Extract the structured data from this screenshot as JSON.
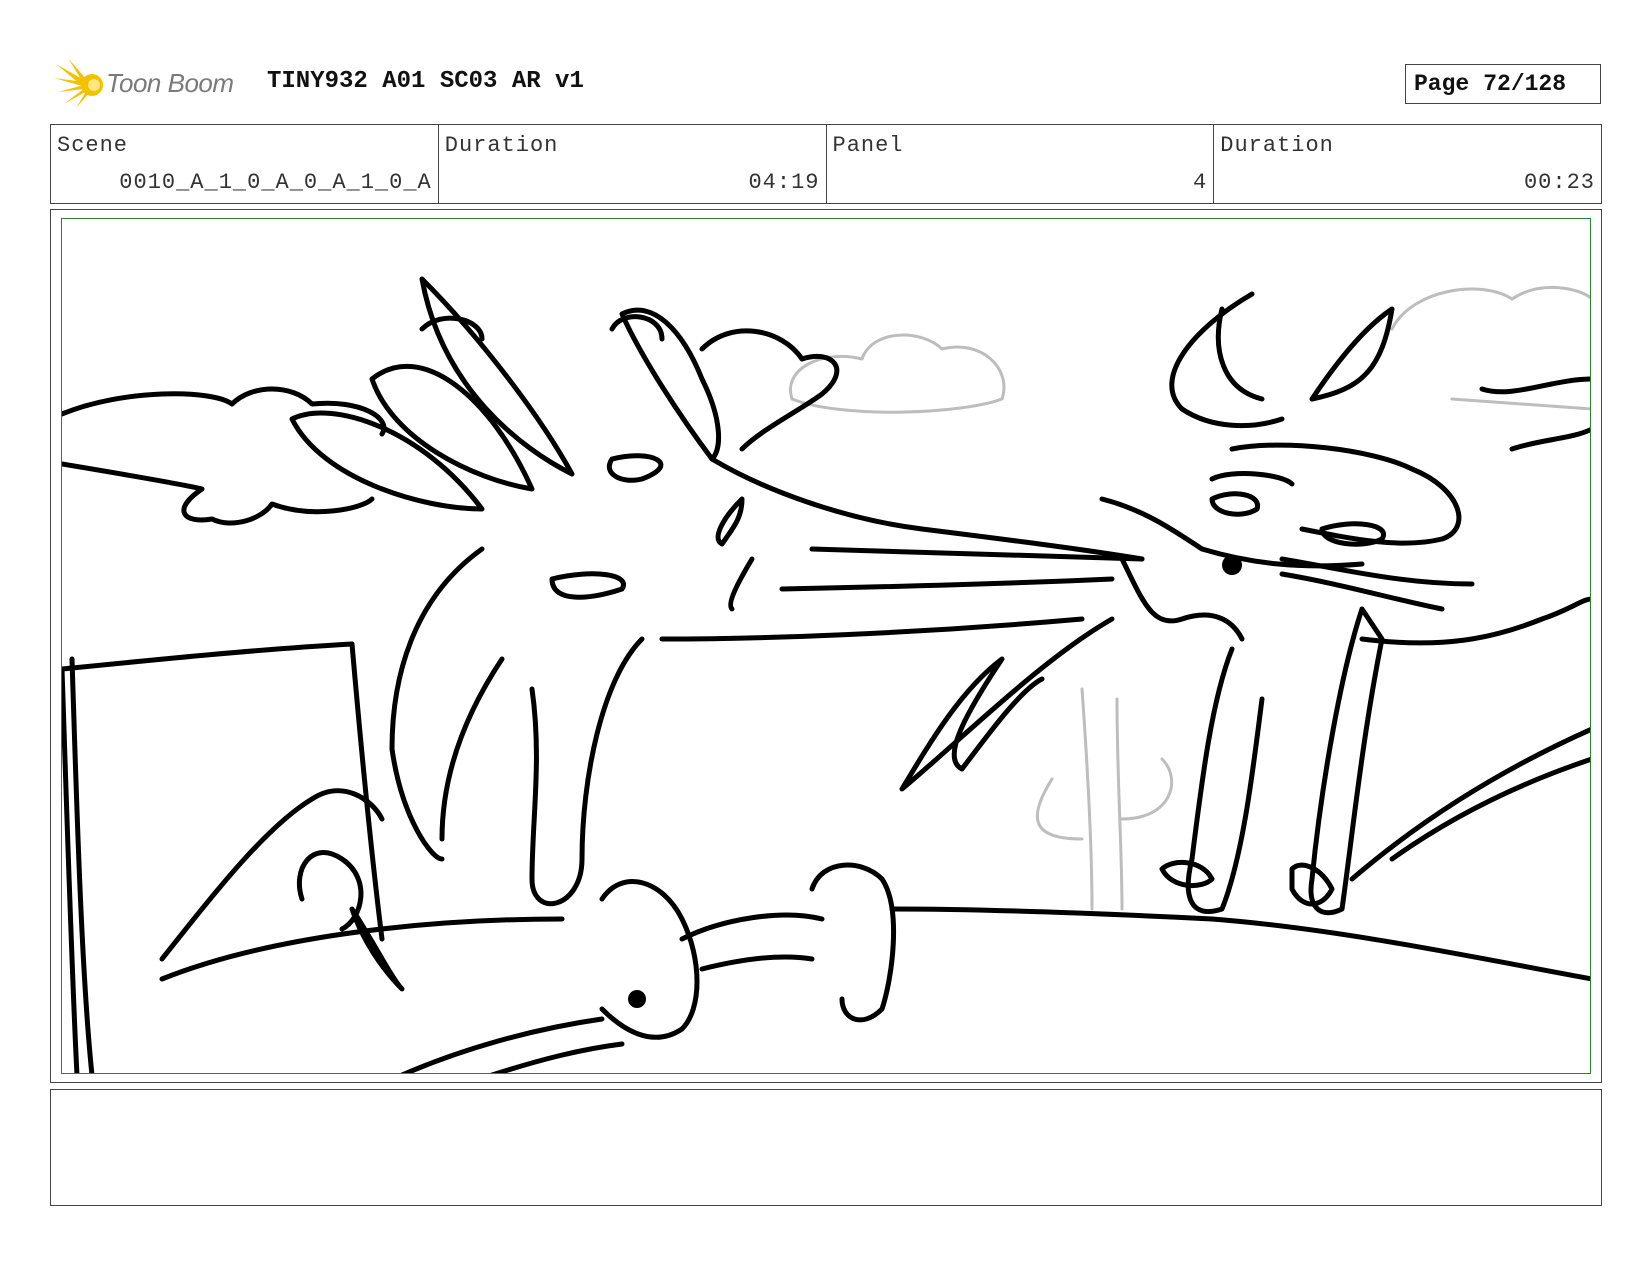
{
  "header": {
    "logo_text": "Toon Boom",
    "doc_title": "TINY932 A01 SC03 AR v1",
    "page_label": "Page",
    "page_value": "72/128"
  },
  "info": {
    "scene_label": "Scene",
    "scene_value": "0010_A_1_0_A_0_A_1_0_A",
    "scene_duration_label": "Duration",
    "scene_duration_value": "04:19",
    "panel_label": "Panel",
    "panel_value": "4",
    "panel_duration_label": "Duration",
    "panel_duration_value": "00:23"
  },
  "notes": {
    "text": ""
  },
  "colors": {
    "safe_area": "#2e7d32",
    "logo_accent": "#f2c200",
    "sketch_ink": "#000000",
    "background_pencil": "#bdbdbd"
  }
}
